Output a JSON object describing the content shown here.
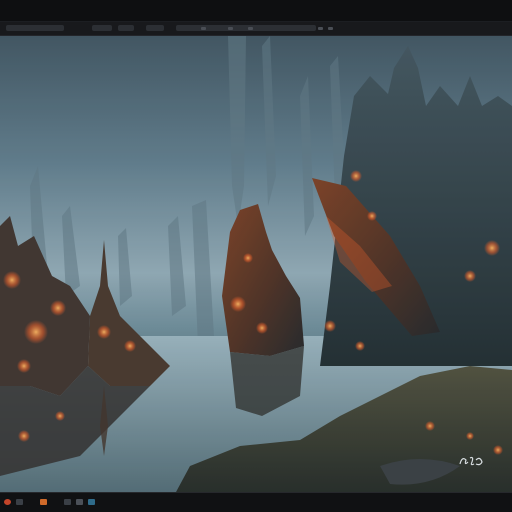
{
  "window": {
    "title": ""
  },
  "menubar": {
    "items": [
      "",
      "",
      "",
      "",
      "",
      ""
    ]
  },
  "scene": {
    "description_icon": "image-canvas",
    "signature_text": "ɞ̈ɕo"
  },
  "statusbar": {
    "buttons": [
      "record-icon",
      "play-icon",
      "download-icon",
      "split-icon",
      "reload-icon",
      "chat-icon"
    ]
  },
  "colors": {
    "accent": "#e5622c",
    "ember": "#ff7a22",
    "fog": "#8ea6b1"
  }
}
